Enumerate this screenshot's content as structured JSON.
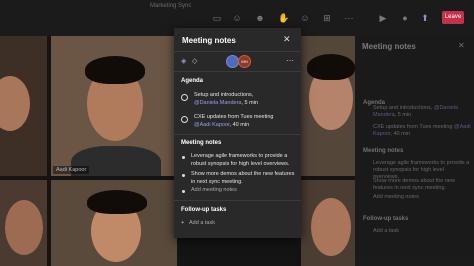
{
  "window": {
    "title": "Marketing Sync"
  },
  "toolbar": {
    "icons": [
      "chat-icon",
      "people-icon",
      "reactions-icon",
      "raise-hand-icon",
      "emoji-icon",
      "apps-icon",
      "more-icon",
      "camera-icon",
      "mic-icon",
      "share-icon"
    ],
    "leave_label": "Leave"
  },
  "participants": [
    {
      "name": "Aadi Kapoor"
    }
  ],
  "side_panel": {
    "title": "Meeting notes",
    "agenda_label": "Agenda",
    "agenda_items": [
      {
        "text": "Setup and introductions,",
        "mention": "@Daniela Mandera",
        "suffix": ", 5 min"
      },
      {
        "text": "CXE updates from Tues meeting",
        "mention": "@Aadi Kapoor",
        "suffix": ", 40 min"
      }
    ],
    "meeting_notes_label": "Meeting notes",
    "notes": [
      "Leverage agile frameworks to provide a robust synopsis for high level overviews.",
      "Show more demos about the new features in next sync meeting."
    ],
    "add_meeting_notes": "Add meeting notes",
    "follow_up_label": "Follow-up tasks",
    "add_task": "Add a task"
  },
  "modal": {
    "title": "Meeting notes",
    "close_label": "✕",
    "more_label": "···",
    "avatars": [
      {
        "initials": ""
      },
      {
        "initials": "MH"
      }
    ],
    "agenda_label": "Agenda",
    "agenda_items": [
      {
        "text": "Setup and introductions,",
        "mention": "@Daniela Mandera",
        "suffix": ", 5 min"
      },
      {
        "text": "CXE updates from Tues meeting",
        "mention": "@Aadi Kapoor",
        "suffix": ", 40 min"
      }
    ],
    "meeting_notes_label": "Meeting notes",
    "notes": [
      "Leverage agile frameworks to provide a robust synopsis for high level overviews.",
      "Show more demos about the new features in next sync meeting."
    ],
    "add_meeting_notes": "Add meeting notes",
    "follow_up_label": "Follow-up tasks",
    "add_task": "Add a task"
  }
}
